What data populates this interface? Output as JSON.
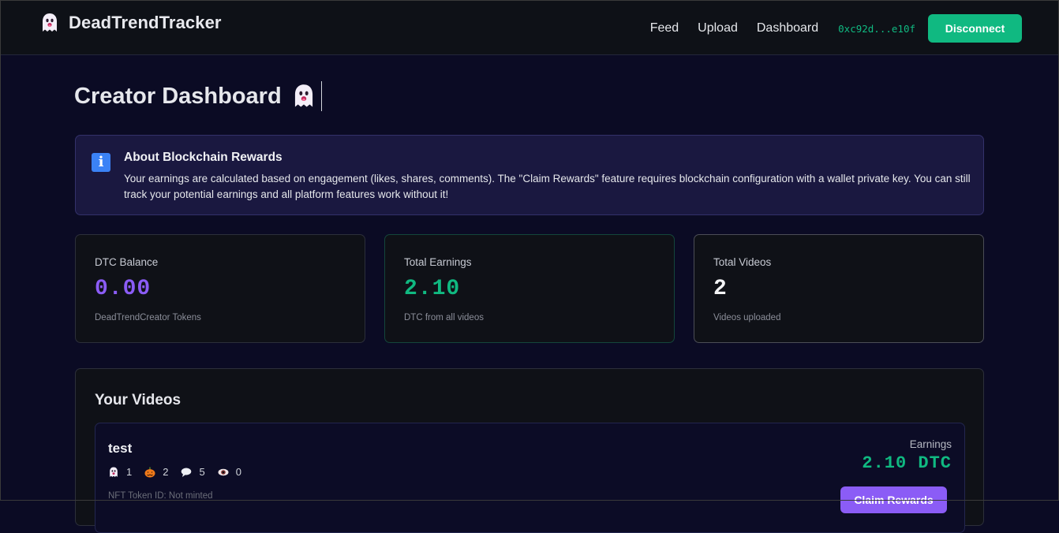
{
  "header": {
    "brand": "DeadTrendTracker",
    "brand_icon": "ghost-icon",
    "nav": [
      "Feed",
      "Upload",
      "Dashboard"
    ],
    "wallet": "0xc92d...e10f",
    "disconnect_label": "Disconnect",
    "accent_color": "#10b981"
  },
  "page": {
    "title": "Creator Dashboard",
    "title_icon": "ghost-icon"
  },
  "info": {
    "icon": "info-icon",
    "title": "About Blockchain Rewards",
    "text": "Your earnings are calculated based on engagement (likes, shares, comments). The \"Claim Rewards\" feature requires blockchain configuration with a wallet private key. You can still track your potential earnings and all platform features work without it!"
  },
  "stats": [
    {
      "label": "DTC Balance",
      "value": "0.00",
      "sub": "DeadTrendCreator Tokens",
      "color": "#8b5cf6"
    },
    {
      "label": "Total Earnings",
      "value": "2.10",
      "sub": "DTC from all videos",
      "color": "#10b981"
    },
    {
      "label": "Total Videos",
      "value": "2",
      "sub": "Videos uploaded",
      "color": "#f3f4f6"
    }
  ],
  "videos": {
    "title": "Your Videos",
    "items": [
      {
        "title": "test",
        "reactions": [
          {
            "icon": "ghost-icon",
            "count": "1"
          },
          {
            "icon": "pumpkin-icon",
            "count": "2"
          },
          {
            "icon": "comment-icon",
            "count": "5"
          },
          {
            "icon": "eye-icon",
            "count": "0"
          }
        ],
        "nft": "NFT Token ID: Not minted",
        "earnings_label": "Earnings",
        "earnings_value": "2.10 DTC",
        "claim_label": "Claim Rewards"
      }
    ]
  }
}
